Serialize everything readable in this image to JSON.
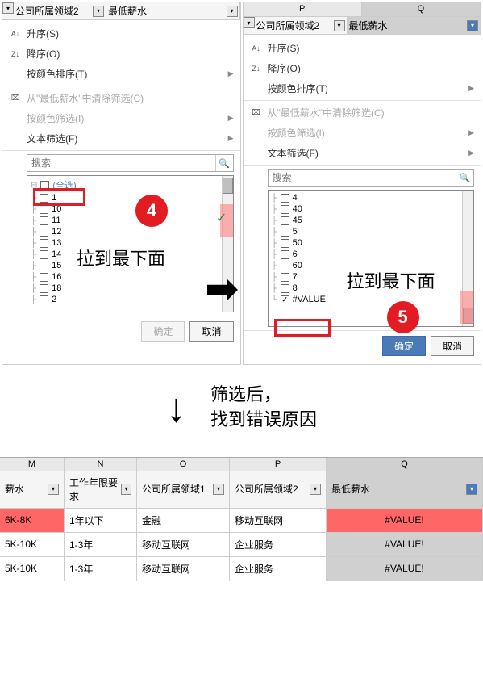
{
  "columns": {
    "P": "P",
    "Q": "Q"
  },
  "header": {
    "field1": "公司所属领域2",
    "field2": "最低薪水"
  },
  "menu": {
    "ascending": "升序(S)",
    "descending": "降序(O)",
    "sortByColor": "按颜色排序(T)",
    "clearFilter": "从\"最低薪水\"中清除筛选(C)",
    "filterByColor": "按颜色筛选(I)",
    "textFilter": "文本筛选(F)",
    "searchPlaceholder": "搜索"
  },
  "leftFilterItems": [
    "(全选)",
    "1",
    "10",
    "11",
    "12",
    "13",
    "14",
    "15",
    "16",
    "18",
    "2"
  ],
  "rightFilterItems": [
    "4",
    "40",
    "45",
    "5",
    "50",
    "6",
    "60",
    "7",
    "8",
    "#VALUE!"
  ],
  "buttons": {
    "ok": "确定",
    "cancel": "取消"
  },
  "annotations": {
    "step4": "4",
    "step5": "5",
    "dragToBottom": "拉到最下面",
    "afterFilter": "筛选后，",
    "findError": "找到错误原因"
  },
  "table": {
    "colLetters": [
      "M",
      "N",
      "O",
      "P",
      "Q"
    ],
    "headers": [
      "薪水",
      "工作年限要求",
      "公司所属领域1",
      "公司所属领域2",
      "最低薪水"
    ],
    "rows": [
      {
        "c1": "6K-8K",
        "c2": "1年以下",
        "c3": "金融",
        "c4": "移动互联网",
        "c5": "#VALUE!",
        "hl": true
      },
      {
        "c1": "5K-10K",
        "c2": "1-3年",
        "c3": "移动互联网",
        "c4": "企业服务",
        "c5": "#VALUE!",
        "hl": false
      },
      {
        "c1": "5K-10K",
        "c2": "1-3年",
        "c3": "移动互联网",
        "c4": "企业服务",
        "c5": "#VALUE!",
        "hl": false
      }
    ]
  }
}
